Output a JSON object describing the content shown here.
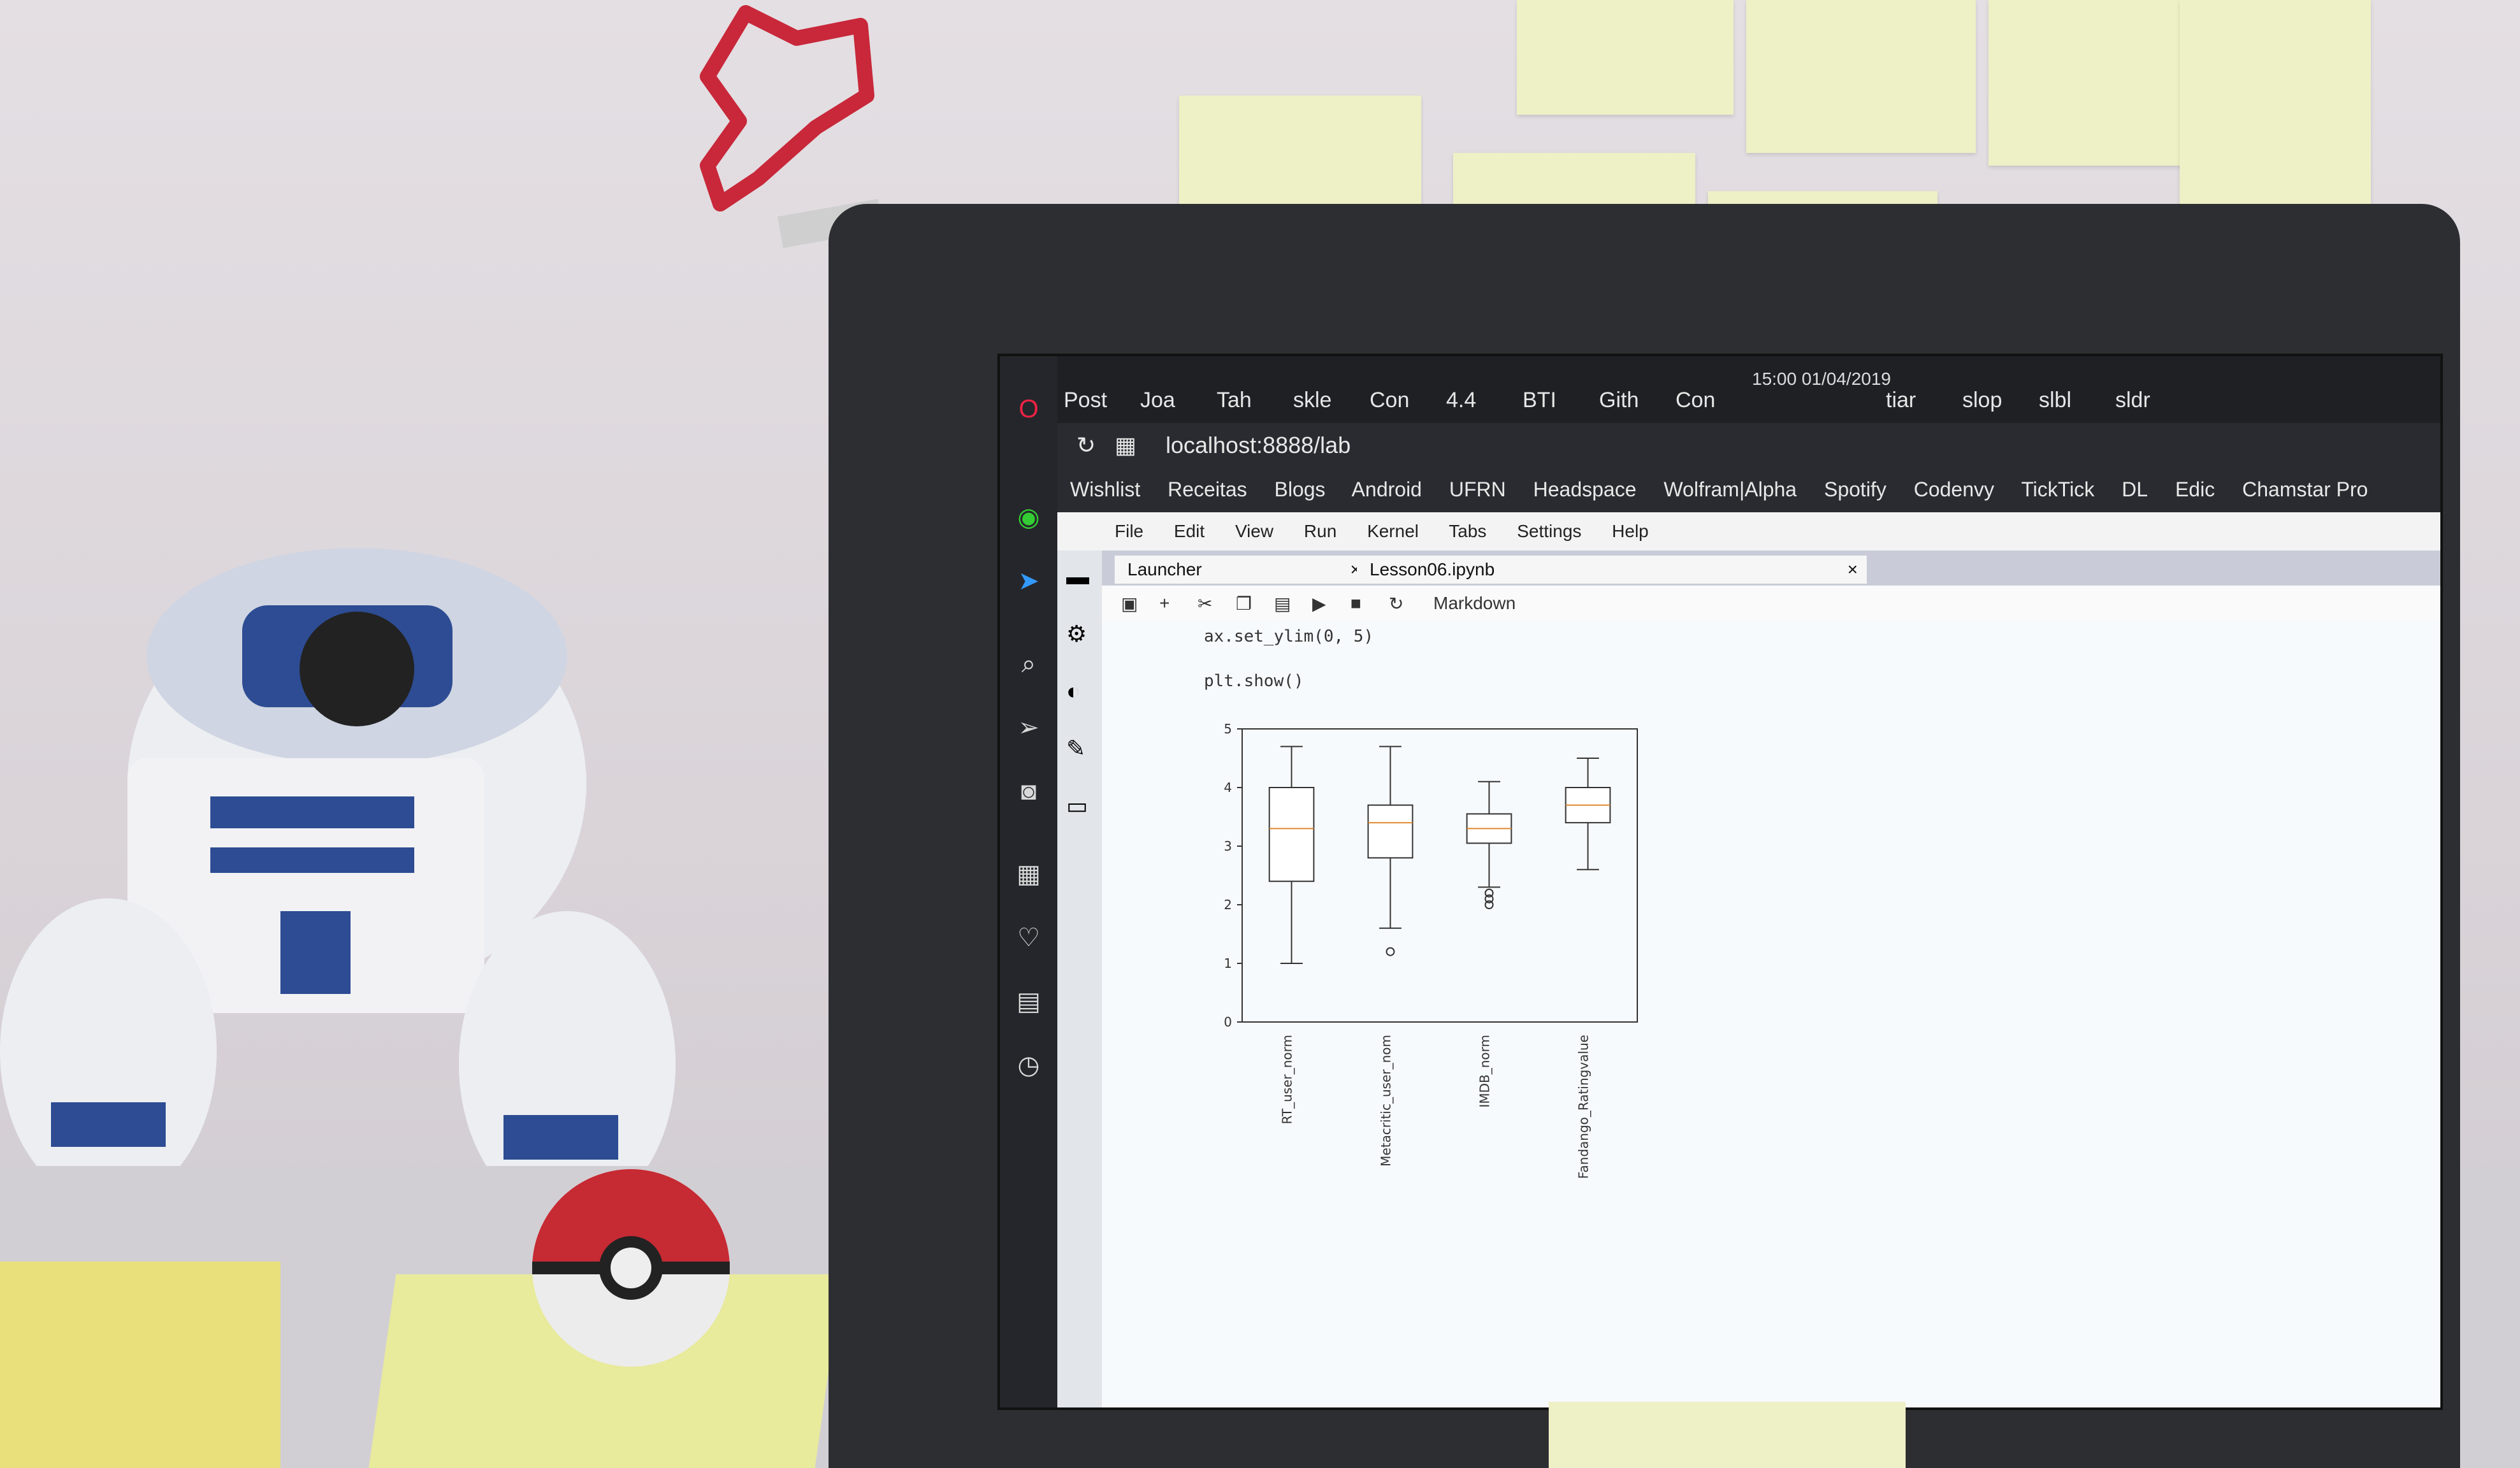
{
  "browser": {
    "tabs": [
      "Post",
      "Joa",
      "Tah",
      "skle",
      "Con",
      "4.4",
      "BTI",
      "Gith",
      "Con",
      "tiar",
      "slop",
      "slbl",
      "sldr"
    ],
    "clock": "15:00 01/04/2019",
    "address": "localhost:8888/lab",
    "bookmarks": [
      "Wishlist",
      "Receitas",
      "Blogs",
      "Android",
      "UFRN",
      "Headspace",
      "Wolfram|Alpha",
      "Spotify",
      "Codenvy",
      "TickTick",
      "DL",
      "Edic",
      "Chamstar Pro"
    ]
  },
  "jupyter": {
    "menu": [
      "File",
      "Edit",
      "View",
      "Run",
      "Kernel",
      "Tabs",
      "Settings",
      "Help"
    ],
    "tabs": [
      "Launcher",
      "Lesson06.ipynb"
    ],
    "cell_type": "Markdown",
    "code_lines": [
      "ax.set_ylim(0, 5)",
      "",
      "plt.show()"
    ]
  },
  "chart_data": {
    "type": "box",
    "title": "",
    "xlabel": "",
    "ylabel": "",
    "ylim": [
      0,
      5
    ],
    "yticks": [
      0,
      1,
      2,
      3,
      4,
      5
    ],
    "categories": [
      "RT_user_norm",
      "Metacritic_user_nom",
      "IMDB_norm",
      "Fandango_Ratingvalue"
    ],
    "boxes": [
      {
        "min": 1.0,
        "q1": 2.4,
        "median": 3.3,
        "q3": 4.0,
        "max": 4.7,
        "outliers": []
      },
      {
        "min": 1.6,
        "q1": 2.8,
        "median": 3.4,
        "q3": 3.7,
        "max": 4.7,
        "outliers": [
          1.2
        ]
      },
      {
        "min": 2.3,
        "q1": 3.05,
        "median": 3.3,
        "q3": 3.55,
        "max": 4.1,
        "outliers": [
          2.0,
          2.1,
          2.2
        ]
      },
      {
        "min": 2.6,
        "q1": 3.4,
        "median": 3.7,
        "q3": 4.0,
        "max": 4.5,
        "outliers": []
      }
    ]
  }
}
